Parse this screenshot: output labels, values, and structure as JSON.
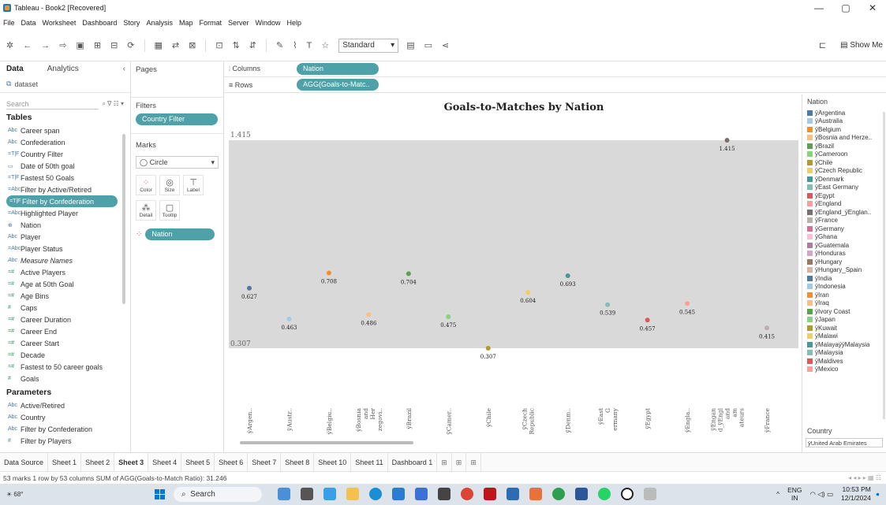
{
  "window": {
    "title": "Tableau - Book2 [Recovered]",
    "controls": [
      "—",
      "▢",
      "✕"
    ]
  },
  "menu": [
    "File",
    "Data",
    "Worksheet",
    "Dashboard",
    "Story",
    "Analysis",
    "Map",
    "Format",
    "Server",
    "Window",
    "Help"
  ],
  "toolbar": {
    "fit_select": "Standard",
    "show_me": "Show Me"
  },
  "datapane": {
    "tab_data": "Data",
    "tab_analytics": "Analytics",
    "source": "dataset",
    "search_placeholder": "Search",
    "tables_title": "Tables",
    "fields": [
      {
        "type": "Abc",
        "name": "Career span"
      },
      {
        "type": "Abc",
        "name": "Confederation"
      },
      {
        "type": "=T|F",
        "name": "Country Filter"
      },
      {
        "type": "▭",
        "name": "Date of 50th goal"
      },
      {
        "type": "=T|F",
        "name": "Fastest 50 Goals"
      },
      {
        "type": "=Abc",
        "name": "Filter by Active/Retired"
      },
      {
        "type": "=T|F",
        "name": "Filter by Confederation"
      },
      {
        "type": "=Abc",
        "name": "Highlighted Player"
      },
      {
        "type": "⊕",
        "name": "Nation"
      },
      {
        "type": "Abc",
        "name": "Player"
      },
      {
        "type": "=Abc",
        "name": "Player Status"
      },
      {
        "type": "Abc",
        "name": "Measure Names"
      },
      {
        "type": "=#",
        "name": "Active Players"
      },
      {
        "type": "=#",
        "name": "Age at 50th Goal"
      },
      {
        "type": "=#",
        "name": "Age Bins"
      },
      {
        "type": "#",
        "name": "Caps"
      },
      {
        "type": "=#",
        "name": "Career Duration"
      },
      {
        "type": "=#",
        "name": "Career End"
      },
      {
        "type": "=#",
        "name": "Career Start"
      },
      {
        "type": "=#",
        "name": "Decade"
      },
      {
        "type": "=#",
        "name": "Fastest to 50 career goals"
      },
      {
        "type": "#",
        "name": "Goals"
      }
    ],
    "parameters_title": "Parameters",
    "parameters": [
      {
        "type": "Abc",
        "name": "Active/Retired"
      },
      {
        "type": "Abc",
        "name": "Country"
      },
      {
        "type": "Abc",
        "name": "Filter by Confederation"
      },
      {
        "type": "#",
        "name": "Filter by Players"
      }
    ]
  },
  "cards": {
    "pages": "Pages",
    "filters": "Filters",
    "filter_pill": "Country Filter",
    "marks": "Marks",
    "mark_type": "Circle",
    "mark_buttons": [
      "Color",
      "Size",
      "Label",
      "Detail",
      "Tooltip"
    ],
    "marks_pill": "Nation"
  },
  "shelves": {
    "columns_label": "Columns",
    "columns_pill": "Nation",
    "rows_label": "Rows",
    "rows_pill": "AGG(Goals-to-Matc.."
  },
  "chart_data": {
    "type": "scatter",
    "title": "Goals-to-Matches by Nation",
    "band_top_label": "1.415",
    "band_bottom_label": "0.307",
    "ylim": [
      0.25,
      1.48
    ],
    "categories": [
      "ÿArgen..",
      "ÿAustr..",
      "ÿBelgiu..",
      "ÿBosnia and Her zegovi..",
      "ÿBrazil",
      "ÿCamer..",
      "ÿChile",
      "ÿCzech Republic",
      "ÿDenm..",
      "ÿEast G ermany",
      "ÿEgypt",
      "ÿEngla..",
      "ÿEngan d_ÿEngl and am ateurs",
      "ÿFrance"
    ],
    "values": [
      0.627,
      0.463,
      0.708,
      0.486,
      0.704,
      0.475,
      0.307,
      0.604,
      0.693,
      0.539,
      0.457,
      0.545,
      1.415,
      0.415
    ],
    "value_labels": [
      "0.627",
      "0.463",
      "0.708",
      "0.486",
      "0.704",
      "0.475",
      "0.307",
      "0.604",
      "0.693",
      "0.539",
      "0.457",
      "0.545",
      "1.415",
      "0.415"
    ],
    "colors": [
      "#4e79a7",
      "#a0cbe8",
      "#f28e2b",
      "#ffbe7d",
      "#59a14f",
      "#8cd17d",
      "#b6992d",
      "#f1ce63",
      "#499894",
      "#86bcb6",
      "#e15759",
      "#ff9d9a",
      "#79706e",
      "#bab0ac"
    ],
    "band_color": "#d9d9d9"
  },
  "legend": {
    "title": "Nation",
    "items": [
      {
        "name": "ÿArgentina",
        "color": "#4e79a7"
      },
      {
        "name": "ÿAustralia",
        "color": "#a0cbe8"
      },
      {
        "name": "ÿBelgium",
        "color": "#f28e2b"
      },
      {
        "name": "ÿBosnia and Herze..",
        "color": "#ffbe7d"
      },
      {
        "name": "ÿBrazil",
        "color": "#59a14f"
      },
      {
        "name": "ÿCameroon",
        "color": "#8cd17d"
      },
      {
        "name": "ÿChile",
        "color": "#b6992d"
      },
      {
        "name": "ÿCzech Republic",
        "color": "#f1ce63"
      },
      {
        "name": "ÿDenmark",
        "color": "#499894"
      },
      {
        "name": "ÿEast Germany",
        "color": "#86bcb6"
      },
      {
        "name": "ÿEgypt",
        "color": "#e15759"
      },
      {
        "name": "ÿEngland",
        "color": "#ff9d9a"
      },
      {
        "name": "ÿEngland_ÿEnglan..",
        "color": "#79706e"
      },
      {
        "name": "ÿFrance",
        "color": "#bab0ac"
      },
      {
        "name": "ÿGermany",
        "color": "#d37295"
      },
      {
        "name": "ÿGhana",
        "color": "#fabfd2"
      },
      {
        "name": "ÿGuatemala",
        "color": "#b07aa1"
      },
      {
        "name": "ÿHonduras",
        "color": "#d4a6c8"
      },
      {
        "name": "ÿHungary",
        "color": "#9d7660"
      },
      {
        "name": "ÿHungary_Spain",
        "color": "#d7b5a6"
      },
      {
        "name": "ÿIndia",
        "color": "#4e79a7"
      },
      {
        "name": "ÿIndonesia",
        "color": "#a0cbe8"
      },
      {
        "name": "ÿIran",
        "color": "#f28e2b"
      },
      {
        "name": "ÿIraq",
        "color": "#ffbe7d"
      },
      {
        "name": "ÿIvory Coast",
        "color": "#59a14f"
      },
      {
        "name": "ÿJapan",
        "color": "#8cd17d"
      },
      {
        "name": "ÿKuwait",
        "color": "#b6992d"
      },
      {
        "name": "ÿMalawi",
        "color": "#f1ce63"
      },
      {
        "name": "ÿMalayaÿÿMalaysia",
        "color": "#499894"
      },
      {
        "name": "ÿMalaysia",
        "color": "#86bcb6"
      },
      {
        "name": "ÿMaldives",
        "color": "#e15759"
      },
      {
        "name": "ÿMexico",
        "color": "#ff9d9a"
      }
    ]
  },
  "country_card": {
    "title": "Country",
    "value": "ÿUnited Arab Emirates"
  },
  "sheet_tabs": [
    "Data Source",
    "Sheet 1",
    "Sheet 2",
    "Sheet 3",
    "Sheet 4",
    "Sheet 5",
    "Sheet 6",
    "Sheet 7",
    "Sheet 8",
    "Sheet 10",
    "Sheet 11",
    "Dashboard 1"
  ],
  "active_sheet": "Sheet 3",
  "status": "53 marks   1 row by 53 columns   SUM of AGG(Goals-to-Match Ratio): 31.246",
  "taskbar": {
    "weather": "68°",
    "search": "Search",
    "lang_top": "ENG",
    "lang_bottom": "IN",
    "time": "10:53 PM",
    "date": "12/1/2024"
  }
}
